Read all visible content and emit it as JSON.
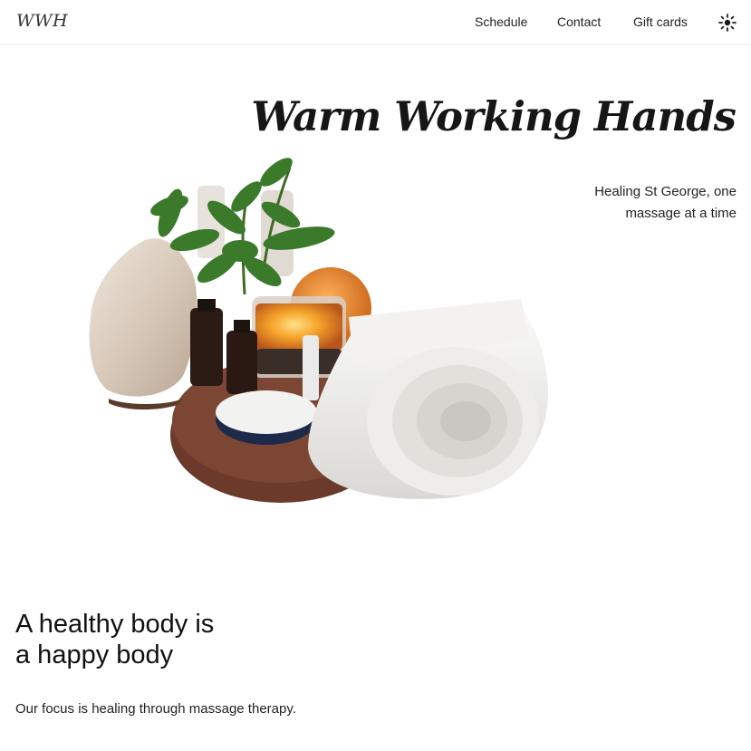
{
  "header": {
    "logo_text": "WWH",
    "nav": {
      "schedule": "Schedule",
      "contact": "Contact",
      "gift_cards": "Gift cards"
    },
    "theme_toggle_icon": "sun-icon"
  },
  "hero": {
    "title": "Warm Working Hands",
    "subtitle": "Healing St George, one massage at a time",
    "image_icon": "spa-still-life-image"
  },
  "intro": {
    "headline_line1": "A healthy body is",
    "headline_line2": "a happy body",
    "text": "Our focus is healing through massage therapy."
  },
  "colors": {
    "background": "#ffffff",
    "text": "#1b1b1b",
    "divider": "#ececec"
  }
}
